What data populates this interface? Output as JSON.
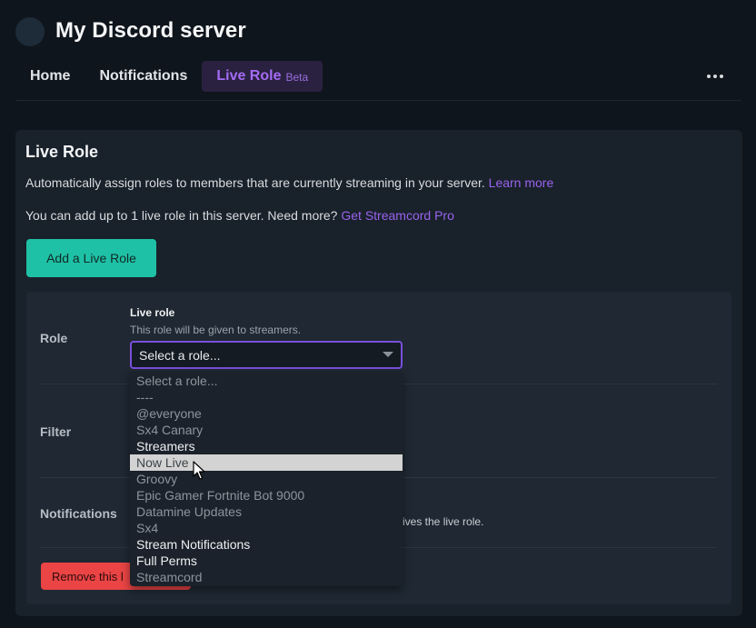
{
  "server": {
    "title": "My Discord server"
  },
  "tabs": [
    {
      "label": "Home"
    },
    {
      "label": "Notifications"
    },
    {
      "label": "Live Role",
      "badge": "Beta"
    }
  ],
  "card": {
    "title": "Live Role",
    "desc1": "Automatically assign roles to members that are currently streaming in your server.",
    "learn_more": "Learn more",
    "desc2": "You can add up to 1 live role in this server. Need more?",
    "get_pro": "Get Streamcord Pro",
    "add_button": "Add a Live Role"
  },
  "form": {
    "role_label": "Role",
    "filter_label": "Filter",
    "notifications_label": "Notifications",
    "field_label": "Live role",
    "field_help": "This role will be given to streamers.",
    "select_value": "Select a role...",
    "notifications_partial": "ives the live role.",
    "remove_button": "Remove this l"
  },
  "dropdown": {
    "options": [
      {
        "label": "Select a role...",
        "enabled": false
      },
      {
        "label": "----",
        "enabled": false
      },
      {
        "label": "@everyone",
        "enabled": false
      },
      {
        "label": "Sx4 Canary",
        "enabled": false
      },
      {
        "label": "Streamers",
        "enabled": true
      },
      {
        "label": "Now Live",
        "enabled": true,
        "hovered": true
      },
      {
        "label": "Groovy",
        "enabled": false
      },
      {
        "label": "Epic Gamer Fortnite Bot 9000",
        "enabled": false
      },
      {
        "label": "Datamine Updates",
        "enabled": false
      },
      {
        "label": "Sx4",
        "enabled": false
      },
      {
        "label": "Stream Notifications",
        "enabled": true
      },
      {
        "label": "Full Perms",
        "enabled": true
      },
      {
        "label": "Streamcord",
        "enabled": false
      }
    ]
  },
  "colors": {
    "accent": "#9a63ee",
    "primary_button": "#1fc1a6",
    "danger_button": "#eb4444"
  }
}
